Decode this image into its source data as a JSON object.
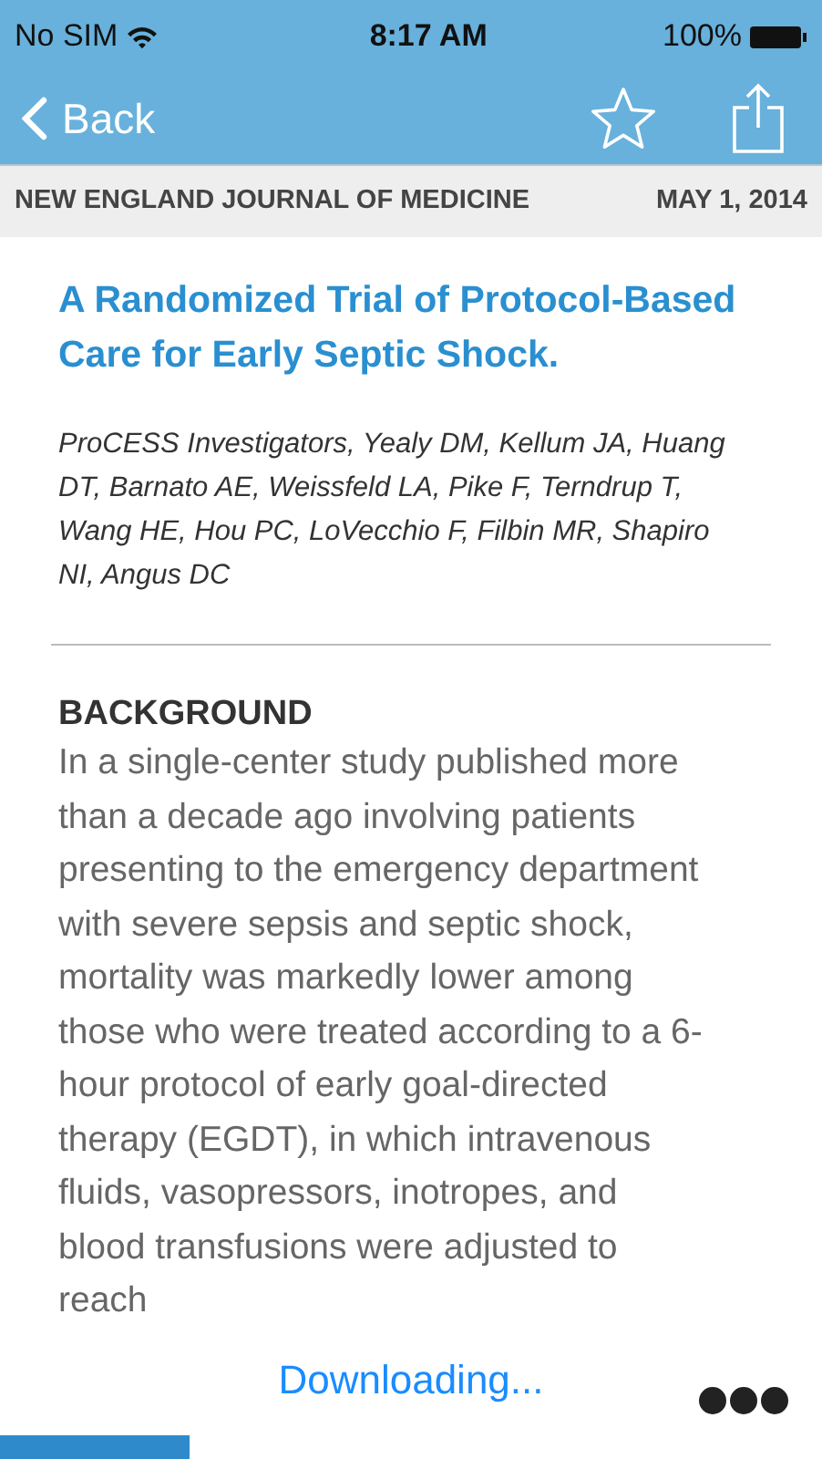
{
  "status_bar": {
    "carrier": "No SIM",
    "time": "8:17 AM",
    "battery": "100%"
  },
  "nav_bar": {
    "back": "Back"
  },
  "header": {
    "journal": "NEW ENGLAND JOURNAL OF MEDICINE",
    "date": "MAY 1, 2014"
  },
  "article": {
    "title": "A Randomized Trial of Protocol-Based Care for Early Septic Shock.",
    "authors": "ProCESS Investigators, Yealy DM, Kellum JA, Huang DT, Barnato AE, Weissfeld LA, Pike F, Terndrup T, Wang HE, Hou PC, LoVecchio F, Filbin MR, Shapiro NI, Angus DC",
    "section_heading": "BACKGROUND",
    "body": "In a single-center study published more than a decade ago involving patients presenting to the emergency department with severe sepsis and septic shock, mortality was markedly lower among those who were treated according to a 6-hour protocol of early goal-directed therapy (EGDT), in which intravenous fluids, vasopressors, inotropes, and blood transfusions were adjusted to reach"
  },
  "bottom_bar": {
    "status": "Downloading...",
    "progress": {
      "level": 0.23
    }
  }
}
